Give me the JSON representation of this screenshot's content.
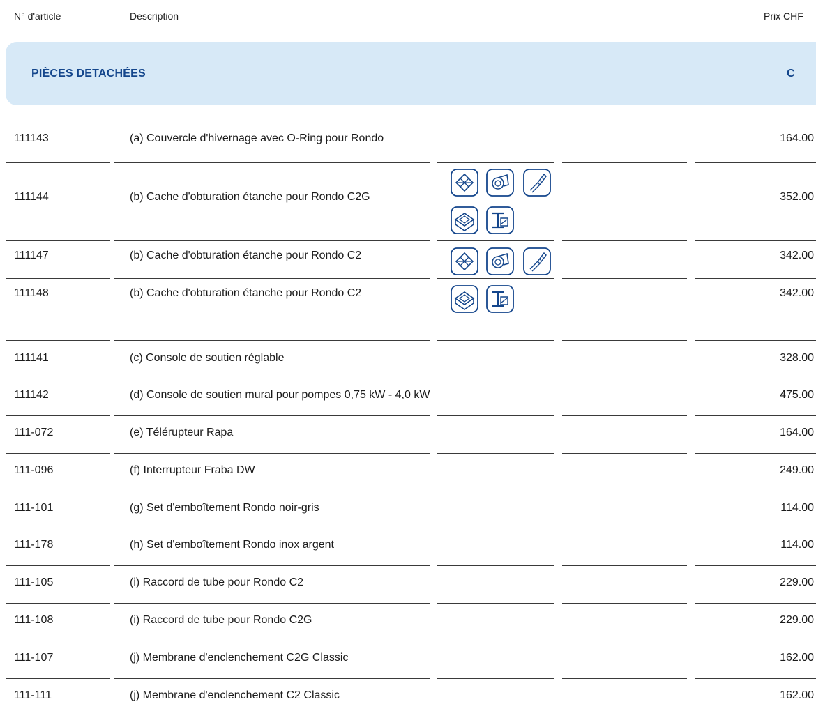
{
  "header": {
    "article_no": "N° d'article",
    "description": "Description",
    "price": "Prix CHF"
  },
  "section": {
    "title": "PIÈCES DETACHÉES",
    "letter": "C"
  },
  "rows": [
    {
      "article": "111143",
      "description": "(a) Couvercle d'hivernage avec O-Ring pour Rondo",
      "price": "164.00"
    },
    {
      "article": "111144",
      "description": "(b) Cache d'obturation étanche pour Rondo C2G",
      "price": "352.00"
    },
    {
      "article": "111147",
      "description": "(b) Cache d'obturation étanche pour Rondo C2",
      "price": "342.00"
    },
    {
      "article": "111148",
      "description": "(b) Cache d'obturation étanche pour Rondo C2",
      "price": "342.00"
    },
    {
      "article": "111141",
      "description": "(c) Console de soutien réglable",
      "price": "328.00"
    },
    {
      "article": "111142",
      "description": "(d) Console de soutien mural pour pompes 0,75 kW - 4,0 kW",
      "price": "475.00"
    },
    {
      "article": "111-072",
      "description": "(e) Télérupteur Rapa",
      "price": "164.00"
    },
    {
      "article": "111-096",
      "description": "(f) Interrupteur Fraba DW",
      "price": "249.00"
    },
    {
      "article": "111-101",
      "description": "(g) Set d'emboîtement Rondo noir-gris",
      "price": "114.00"
    },
    {
      "article": "111-178",
      "description": "(h) Set d'emboîtement Rondo inox argent",
      "price": "114.00"
    },
    {
      "article": "111-105",
      "description": "(i) Raccord de tube pour Rondo C2",
      "price": "229.00"
    },
    {
      "article": "111-108",
      "description": "(i) Raccord de tube pour Rondo C2G",
      "price": "229.00"
    },
    {
      "article": "111-107",
      "description": "(j) Membrane d'enclenchement C2G Classic",
      "price": "162.00"
    },
    {
      "article": "111-111",
      "description": "(j) Membrane d'enclenchement C2 Classic",
      "price": "162.00"
    }
  ],
  "pictograms": {
    "row_111144": [
      "tile-icon",
      "roll-icon",
      "brush-icon",
      "box-icon",
      "ibeam-icon"
    ],
    "row_111147": [
      "tile-icon",
      "roll-icon",
      "brush-icon"
    ],
    "row_111148": [
      "box-icon",
      "ibeam-icon"
    ]
  },
  "colors": {
    "band": "#d7e9f7",
    "accent": "#14468c",
    "rule": "#3a3a3a"
  }
}
